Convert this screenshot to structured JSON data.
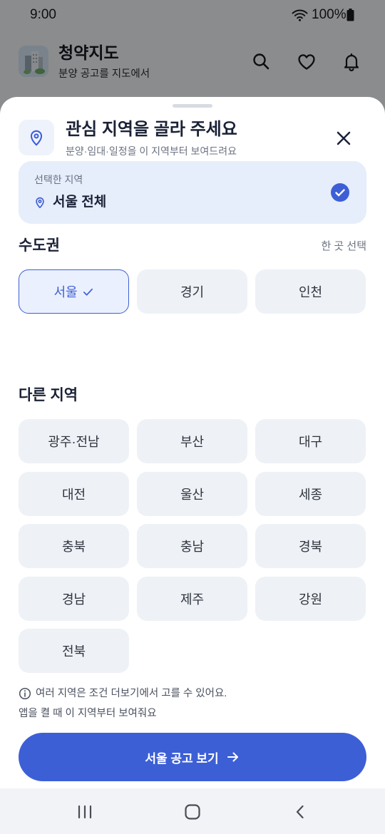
{
  "status_bar": {
    "time": "9:00",
    "battery_text": "100%",
    "icons": [
      "wifi-icon",
      "battery-icon"
    ]
  },
  "app_header": {
    "title": "청약지도",
    "subtitle": "분양 공고를 지도에서",
    "actions": [
      "search-icon",
      "heart-icon",
      "bell-icon"
    ]
  },
  "sheet": {
    "header_icon": "map-pin-icon",
    "title": "관심 지역을 골라 주세요",
    "subtitle": "분양·임대·일정을 이 지역부터 보여드려요",
    "close_icon": "close-icon",
    "selected_region": {
      "label": "선택한 지역",
      "value": "서울 전체",
      "checked": true
    },
    "capital_area": {
      "title": "수도권",
      "hint": "한 곳 선택",
      "regions": [
        {
          "label": "서울",
          "selected": true
        },
        {
          "label": "경기",
          "selected": false
        },
        {
          "label": "인천",
          "selected": false
        }
      ]
    },
    "other_regions": {
      "title": "다른 지역",
      "regions": [
        {
          "label": "광주·전남",
          "selected": false
        },
        {
          "label": "부산",
          "selected": false
        },
        {
          "label": "대구",
          "selected": false
        },
        {
          "label": "대전",
          "selected": false
        },
        {
          "label": "울산",
          "selected": false
        },
        {
          "label": "세종",
          "selected": false
        },
        {
          "label": "충북",
          "selected": false
        },
        {
          "label": "충남",
          "selected": false
        },
        {
          "label": "경북",
          "selected": false
        },
        {
          "label": "경남",
          "selected": false
        },
        {
          "label": "제주",
          "selected": false
        },
        {
          "label": "강원",
          "selected": false
        },
        {
          "label": "전북",
          "selected": false
        }
      ]
    },
    "note": "여러 지역은 조건 더보기에서 고를 수 있어요.",
    "footnote": "앱을 켤 때 이 지역부터 보여줘요",
    "cta_label": "서울 공고 보기"
  },
  "nav_bar": {
    "buttons": [
      "recents-icon",
      "home-icon",
      "back-icon"
    ]
  },
  "colors": {
    "accent": "#3d5fd6",
    "chip_bg": "#eef1f6",
    "selected_card_bg": "#e6edfb",
    "title_text": "#1b2236"
  }
}
